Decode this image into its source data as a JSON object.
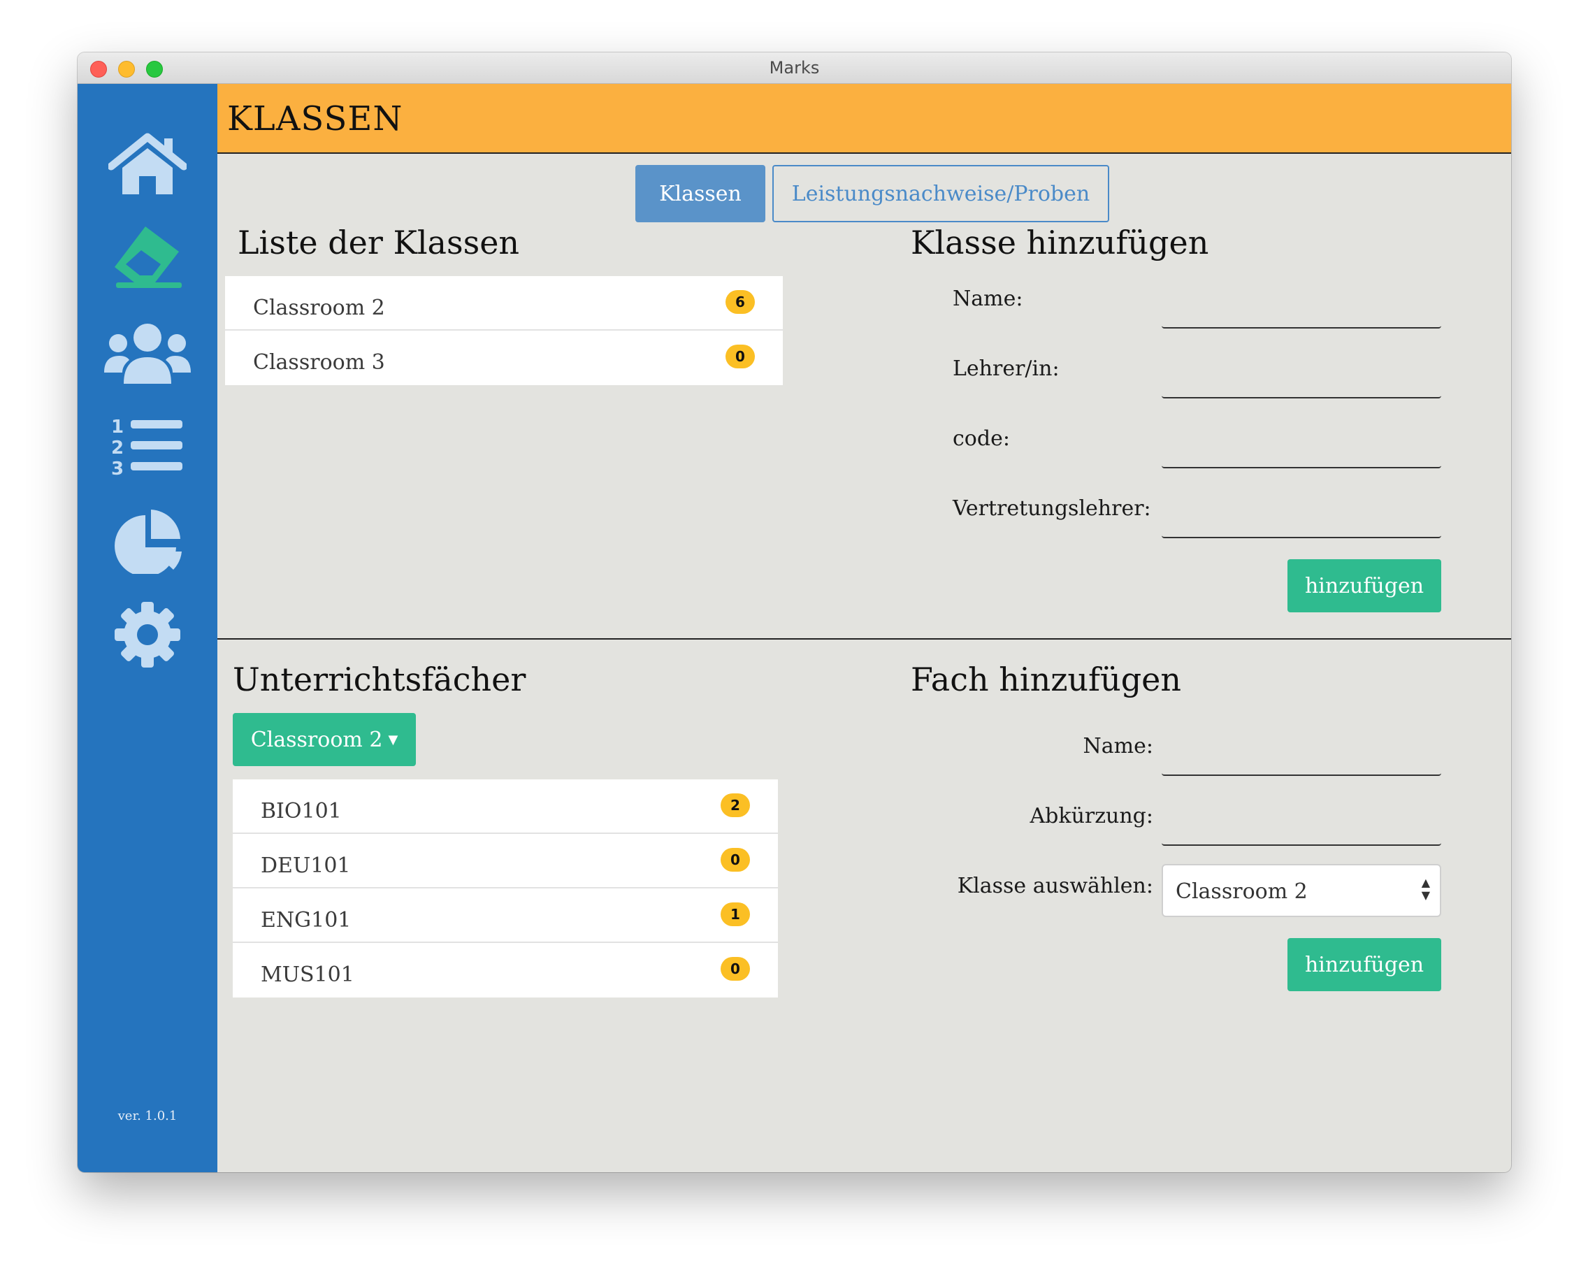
{
  "window": {
    "title": "Marks"
  },
  "sidebar": {
    "icons": [
      "home-icon",
      "eraser-icon",
      "users-icon",
      "ordered-list-icon",
      "pie-chart-icon",
      "gear-icon"
    ],
    "version": "ver. 1.0.1",
    "colors": {
      "background": "#2574be",
      "icon": "#c3dcf3",
      "active_icon": "#2fbb8f"
    }
  },
  "header": {
    "title": "KLASSEN",
    "color": "#fbb040"
  },
  "tabs": [
    {
      "label": "Klassen",
      "active": true
    },
    {
      "label": "Leistungsnachweise/Proben",
      "active": false
    }
  ],
  "classes": {
    "heading": "Liste der Klassen",
    "items": [
      {
        "name": "Classroom 2",
        "count": "6"
      },
      {
        "name": "Classroom 3",
        "count": "0"
      }
    ]
  },
  "add_class": {
    "heading": "Klasse hinzufügen",
    "fields": [
      {
        "label": "Name:",
        "value": ""
      },
      {
        "label": "Lehrer/in:",
        "value": ""
      },
      {
        "label": "code:",
        "value": ""
      },
      {
        "label": "Vertretungslehrer:",
        "value": ""
      }
    ],
    "button": "hinzufügen"
  },
  "subjects": {
    "heading": "Unterrichtsfächer",
    "dropdown": "Classroom 2",
    "items": [
      {
        "name": "BIO101",
        "count": "2"
      },
      {
        "name": "DEU101",
        "count": "0"
      },
      {
        "name": "ENG101",
        "count": "1"
      },
      {
        "name": "MUS101",
        "count": "0"
      }
    ]
  },
  "add_subject": {
    "heading": "Fach hinzufügen",
    "fields": [
      {
        "label": "Name:",
        "value": ""
      },
      {
        "label": "Abkürzung:",
        "value": ""
      }
    ],
    "select_label": "Klasse auswählen:",
    "select_value": "Classroom 2",
    "button": "hinzufügen"
  },
  "colors": {
    "accent_green": "#2fbb8f",
    "badge": "#fbbf24",
    "tab_active": "#5a93c9"
  }
}
